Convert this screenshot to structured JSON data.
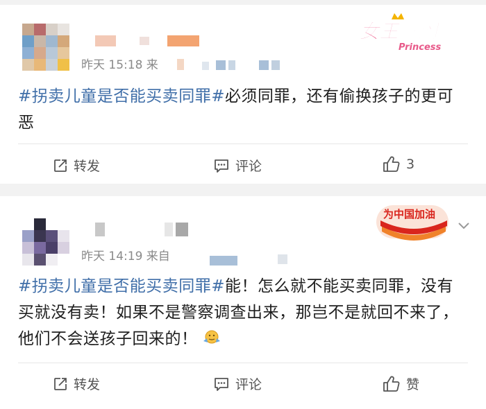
{
  "posts": [
    {
      "time_text": "昨天 15:18 来",
      "hashtag": "#拐卖儿童是否能买卖同罪#",
      "body": "必须同罪，还有偷换孩子的更可恶",
      "badge_title": "女王驾到",
      "badge_sub": "Princess",
      "actions": {
        "repost": "转发",
        "comment": "评论",
        "like": "3"
      }
    },
    {
      "time_text": "昨天 14:19 来自",
      "hashtag": "#拐卖儿童是否能买卖同罪#",
      "body": "能！怎么就不能买卖同罪，没有买就没有卖！如果不是警察调查出来，那岂不是就回不来了，他们不会送孩子回来的！",
      "badge_title": "为中国加油",
      "actions": {
        "repost": "转发",
        "comment": "评论",
        "like": "赞"
      }
    }
  ],
  "colors": {
    "hashtag": "#3f6ea8",
    "meta": "#8a8a8a",
    "badge_pink": "#e8336d",
    "badge_red": "#d9251d"
  }
}
